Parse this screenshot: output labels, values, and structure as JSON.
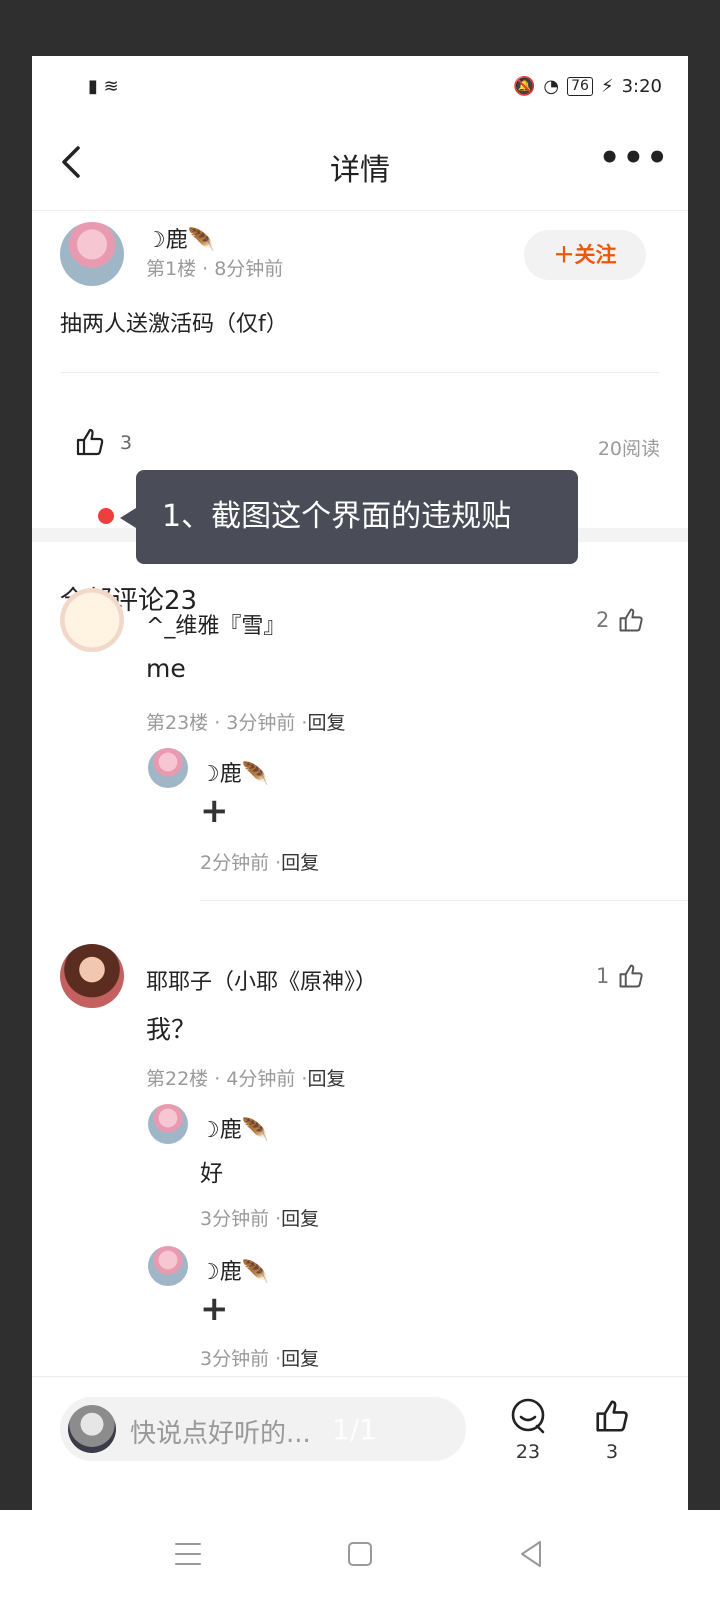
{
  "status": {
    "left_icons": "▮ ≋",
    "battery": "76",
    "time": "3:20"
  },
  "topbar": {
    "title": "详情",
    "more": "•••"
  },
  "post": {
    "author": "☽鹿🪶",
    "meta": "第1楼 · 8分钟前",
    "follow_label": "＋关注",
    "text": "抽两人送激活码（仅f）",
    "likes": "3",
    "reads": "20阅读"
  },
  "tooltip": "1、截图这个界面的违规贴",
  "comments_header": "全部评论23",
  "comments": [
    {
      "user": "^_维雅『雪』",
      "text": "me",
      "meta": "第23楼 · 3分钟前 ·",
      "reply_label": "回复",
      "likes": "2",
      "replies": [
        {
          "user": "☽鹿🪶",
          "text": "+",
          "meta": "2分钟前 ·",
          "reply_label": "回复"
        }
      ]
    },
    {
      "user": "耶耶子（小耶《原神》）",
      "text": "我？",
      "meta": "第22楼 · 4分钟前 ·",
      "reply_label": "回复",
      "likes": "1",
      "replies": [
        {
          "user": "☽鹿🪶",
          "text": "好",
          "meta": "3分钟前 ·",
          "reply_label": "回复"
        },
        {
          "user": "☽鹿🪶",
          "text": "+",
          "meta": "3分钟前 ·",
          "reply_label": "回复"
        }
      ]
    }
  ],
  "bottombar": {
    "placeholder": "快说点好听的...",
    "page_indicator": "1/1",
    "comment_count": "23",
    "like_count": "3"
  }
}
